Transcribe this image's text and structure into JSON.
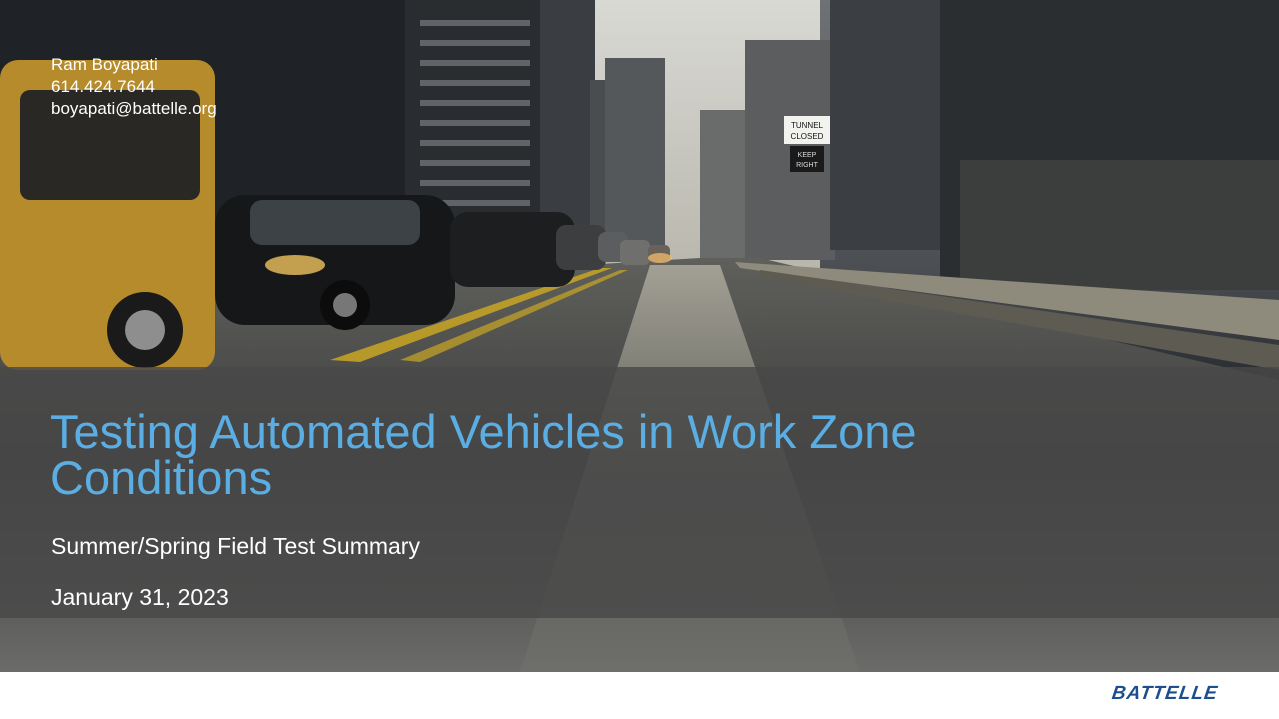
{
  "contact": {
    "name": "Ram Boyapati",
    "phone": "614.424.7644",
    "email": "boyapati@battelle.org"
  },
  "title": "Testing Automated Vehicles in Work Zone Conditions",
  "subtitle": "Summer/Spring Field Test Summary",
  "date": "January 31, 2023",
  "logo": "BATTELLE",
  "street_sign": {
    "line1": "TUNNEL",
    "line2": "CLOSED",
    "line3": "KEEP",
    "line4": "RIGHT"
  },
  "colors": {
    "title": "#5aaee3",
    "band": "#484848",
    "logo": "#1c4f8c"
  }
}
